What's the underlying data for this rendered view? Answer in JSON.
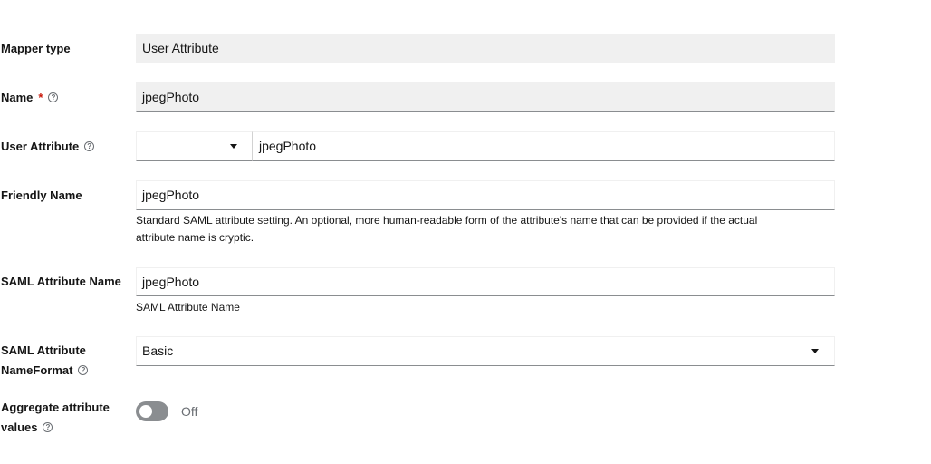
{
  "form": {
    "mapper_type": {
      "label": "Mapper type",
      "value": "User Attribute"
    },
    "name": {
      "label": "Name",
      "required_mark": "*",
      "value": "jpegPhoto"
    },
    "user_attribute": {
      "label": "User Attribute",
      "select_value": "",
      "value": "jpegPhoto"
    },
    "friendly_name": {
      "label": "Friendly Name",
      "value": "jpegPhoto",
      "helper_line1": "Standard SAML attribute setting. An optional, more human-readable form of the attribute's name that can be provided if the actual",
      "helper_line2": "attribute name is cryptic."
    },
    "saml_attribute_name": {
      "label": "SAML Attribute Name",
      "value": "jpegPhoto",
      "helper": "SAML Attribute Name"
    },
    "saml_attribute_nameformat": {
      "label_line1": "SAML Attribute",
      "label_line2": "NameFormat",
      "value": "Basic"
    },
    "aggregate_attribute_values": {
      "label_line1": "Aggregate attribute",
      "label_line2": "values",
      "state_label": "Off",
      "enabled": false
    }
  },
  "icons": {
    "help": "help-circle-icon",
    "caret": "caret-down-icon"
  },
  "colors": {
    "required": "#c9190b",
    "toggle_off": "#8a8d90",
    "readonly_bg": "#f0f0f0"
  }
}
